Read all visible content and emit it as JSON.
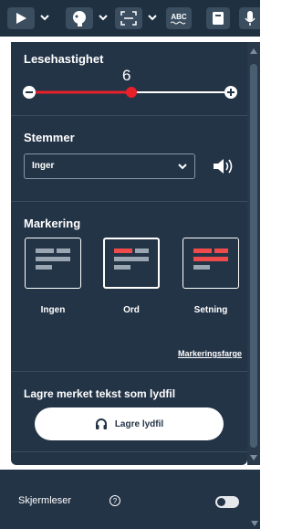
{
  "toolbar": {
    "icons": [
      "play-icon",
      "face-icon",
      "screen-mask-icon",
      "abc-spellcheck-icon",
      "book-icon",
      "microphone-icon"
    ],
    "abc_label": "ABC"
  },
  "speed": {
    "title": "Lesehastighet",
    "value": "6",
    "fraction": 0.45,
    "accent": "#e8202a"
  },
  "voices": {
    "title": "Stemmer",
    "selected": "Inger"
  },
  "highlight": {
    "title": "Markering",
    "options": [
      {
        "label": "Ingen",
        "color": "#9aa7b3"
      },
      {
        "label": "Ord",
        "color": "#ef4b4b"
      },
      {
        "label": "Setning",
        "color": "#ef4b4b"
      }
    ],
    "color_link": "Markeringsfarge"
  },
  "save": {
    "title": "Lagre merket tekst som lydfil",
    "button_label": "Lagre lydfil"
  },
  "footer": {
    "screen_reader_label": "Skjermleser",
    "help_symbol": "?"
  }
}
